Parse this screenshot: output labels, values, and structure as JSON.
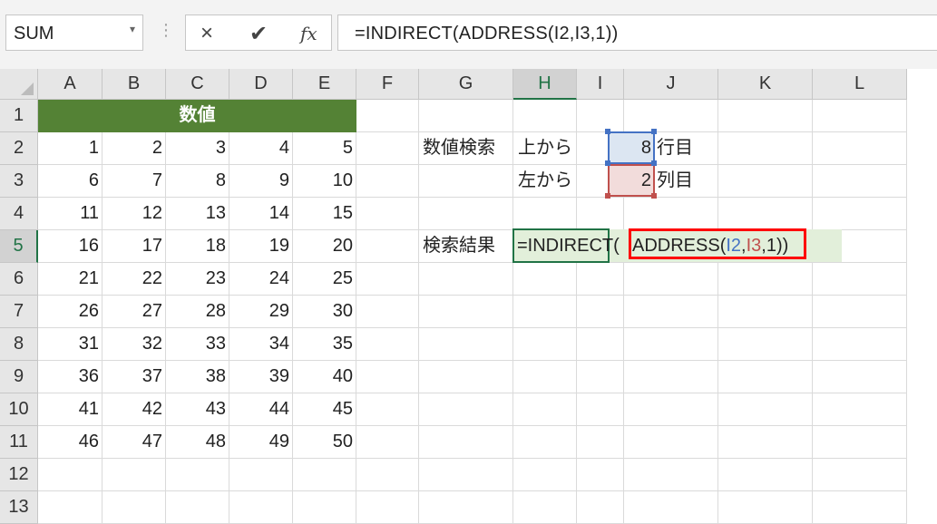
{
  "name_box": {
    "value": "SUM",
    "dropdown_icon": "chevron-down-icon"
  },
  "formula_buttons": {
    "cancel_icon": "×",
    "enter_icon": "✔",
    "fx_label": "fx"
  },
  "formula_bar": {
    "value": "=INDIRECT(ADDRESS(I2,I3,1))"
  },
  "column_headers": [
    "A",
    "B",
    "C",
    "D",
    "E",
    "F",
    "G",
    "H",
    "I",
    "J",
    "K",
    "L"
  ],
  "row_headers": [
    "1",
    "2",
    "3",
    "4",
    "5",
    "6",
    "7",
    "8",
    "9",
    "10",
    "11",
    "12",
    "13"
  ],
  "table": {
    "title": "数値",
    "rows": [
      [
        "1",
        "2",
        "3",
        "4",
        "5"
      ],
      [
        "6",
        "7",
        "8",
        "9",
        "10"
      ],
      [
        "11",
        "12",
        "13",
        "14",
        "15"
      ],
      [
        "16",
        "17",
        "18",
        "19",
        "20"
      ],
      [
        "21",
        "22",
        "23",
        "24",
        "25"
      ],
      [
        "26",
        "27",
        "28",
        "29",
        "30"
      ],
      [
        "31",
        "32",
        "33",
        "34",
        "35"
      ],
      [
        "36",
        "37",
        "38",
        "39",
        "40"
      ],
      [
        "41",
        "42",
        "43",
        "44",
        "45"
      ],
      [
        "46",
        "47",
        "48",
        "49",
        "50"
      ]
    ]
  },
  "search": {
    "label": "数値検索",
    "from_top_label": "上から",
    "from_top_value": "8",
    "row_suffix": "行目",
    "from_left_label": "左から",
    "from_left_value": "2",
    "col_suffix": "列目",
    "result_label": "検索結果"
  },
  "edit_cell": {
    "part1": "=INDIRECT(",
    "part2": "ADDRESS(",
    "ref1": "I2",
    "comma1": ",",
    "ref2": "I3",
    "part3": ",1))"
  },
  "colors": {
    "header_green": "#548235",
    "selection_green": "#217346",
    "ref_blue": "#4472c4",
    "ref_red": "#c0504d",
    "highlight_box": "#ff0000",
    "edit_fill": "#e2efda"
  }
}
